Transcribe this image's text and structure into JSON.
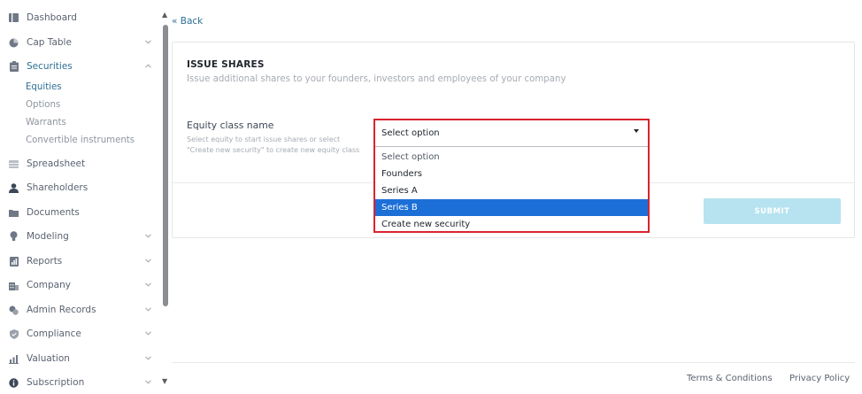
{
  "sidebar": {
    "items": [
      {
        "label": "Dashboard",
        "icon": "dashboard-icon"
      },
      {
        "label": "Cap Table",
        "icon": "pie-chart-icon",
        "chevron": "v"
      },
      {
        "label": "Securities",
        "icon": "clipboard-icon",
        "chevron": "^"
      },
      {
        "label": "Spreadsheet",
        "icon": "spreadsheet-icon"
      },
      {
        "label": "Shareholders",
        "icon": "user-icon"
      },
      {
        "label": "Documents",
        "icon": "folder-icon"
      },
      {
        "label": "Modeling",
        "icon": "lightbulb-icon",
        "chevron": "v"
      },
      {
        "label": "Reports",
        "icon": "report-icon",
        "chevron": "v"
      },
      {
        "label": "Company",
        "icon": "building-icon",
        "chevron": "v"
      },
      {
        "label": "Admin Records",
        "icon": "records-icon",
        "chevron": "v"
      },
      {
        "label": "Compliance",
        "icon": "shield-icon",
        "chevron": "v"
      },
      {
        "label": "Valuation",
        "icon": "chart-icon",
        "chevron": "v"
      },
      {
        "label": "Subscription",
        "icon": "info-icon",
        "chevron": "v"
      }
    ],
    "sub_items": [
      "Equities",
      "Options",
      "Warrants",
      "Convertible instruments"
    ],
    "scroll_up": "▲",
    "scroll_down": "▼"
  },
  "back": "« Back",
  "card": {
    "title": "ISSUE SHARES",
    "subtitle": "Issue additional shares to your founders, investors and employees of your company",
    "field_label": "Equity class name",
    "field_help": "Select equity to start issue shares or select \"Create new security\" to create new equity class",
    "select_value": "Select option",
    "options": [
      "Select option",
      "Founders",
      "Series A",
      "Series B",
      "Create new security"
    ],
    "highlighted_option": "Series B",
    "submit_label": "SUBMIT"
  },
  "footer": {
    "terms": "Terms & Conditions",
    "privacy": "Privacy Policy"
  },
  "colors": {
    "accent": "#2d6f95",
    "highlight": "#1c6fd6",
    "outline": "#d9232e",
    "submit_disabled": "#b6e3ef"
  }
}
